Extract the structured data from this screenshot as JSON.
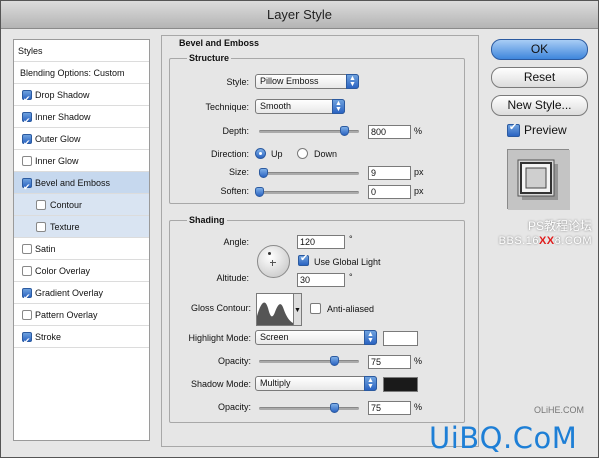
{
  "window": {
    "title": "Layer Style"
  },
  "left_list": {
    "items": [
      {
        "label": "Styles",
        "checkbox": false,
        "checked": false,
        "selected": false,
        "sub": false
      },
      {
        "label": "Blending Options: Custom",
        "checkbox": false,
        "checked": false,
        "selected": false,
        "sub": false
      },
      {
        "label": "Drop Shadow",
        "checkbox": true,
        "checked": true,
        "selected": false,
        "sub": false
      },
      {
        "label": "Inner Shadow",
        "checkbox": true,
        "checked": true,
        "selected": false,
        "sub": false
      },
      {
        "label": "Outer Glow",
        "checkbox": true,
        "checked": true,
        "selected": false,
        "sub": false
      },
      {
        "label": "Inner Glow",
        "checkbox": true,
        "checked": false,
        "selected": false,
        "sub": false
      },
      {
        "label": "Bevel and Emboss",
        "checkbox": true,
        "checked": true,
        "selected": true,
        "sub": false
      },
      {
        "label": "Contour",
        "checkbox": true,
        "checked": false,
        "selected": false,
        "sub": true
      },
      {
        "label": "Texture",
        "checkbox": true,
        "checked": false,
        "selected": false,
        "sub": true
      },
      {
        "label": "Satin",
        "checkbox": true,
        "checked": false,
        "selected": false,
        "sub": false
      },
      {
        "label": "Color Overlay",
        "checkbox": true,
        "checked": false,
        "selected": false,
        "sub": false
      },
      {
        "label": "Gradient Overlay",
        "checkbox": true,
        "checked": true,
        "selected": false,
        "sub": false
      },
      {
        "label": "Pattern Overlay",
        "checkbox": true,
        "checked": false,
        "selected": false,
        "sub": false
      },
      {
        "label": "Stroke",
        "checkbox": true,
        "checked": true,
        "selected": false,
        "sub": false
      }
    ]
  },
  "panel": {
    "title": "Bevel and Emboss",
    "structure": {
      "title": "Structure",
      "style_label": "Style:",
      "style_value": "Pillow Emboss",
      "technique_label": "Technique:",
      "technique_value": "Smooth",
      "depth_label": "Depth:",
      "depth_value": "800",
      "depth_unit": "%",
      "depth_level": 0.85,
      "direction_label": "Direction:",
      "direction_up": "Up",
      "direction_down": "Down",
      "direction_selected": "Up",
      "size_label": "Size:",
      "size_value": "9",
      "size_unit": "px",
      "size_level": 0.04,
      "soften_label": "Soften:",
      "soften_value": "0",
      "soften_unit": "px",
      "soften_level": 0.0
    },
    "shading": {
      "title": "Shading",
      "angle_label": "Angle:",
      "angle_value": "120",
      "angle_unit": "°",
      "use_global_light": "Use Global Light",
      "use_global_light_checked": true,
      "altitude_label": "Altitude:",
      "altitude_value": "30",
      "altitude_unit": "°",
      "gloss_contour_label": "Gloss Contour:",
      "anti_aliased": "Anti-aliased",
      "anti_aliased_checked": false,
      "highlight_mode_label": "Highlight Mode:",
      "highlight_mode_value": "Screen",
      "highlight_color": "#ffffff",
      "highlight_opacity_label": "Opacity:",
      "highlight_opacity_value": "75",
      "highlight_opacity_unit": "%",
      "highlight_opacity_level": 0.75,
      "shadow_mode_label": "Shadow Mode:",
      "shadow_mode_value": "Multiply",
      "shadow_color": "#1a1a1a",
      "shadow_opacity_label": "Opacity:",
      "shadow_opacity_value": "75",
      "shadow_opacity_unit": "%",
      "shadow_opacity_level": 0.75
    }
  },
  "buttons": {
    "ok": "OK",
    "cancel": "Reset",
    "new_style": "New Style...",
    "preview": "Preview",
    "preview_checked": true
  },
  "watermarks": {
    "line1": "PS教程论坛",
    "line2_prefix": "BBS.16",
    "line2_red": "XX",
    "line2_suffix": "8.COM",
    "line3": "OLiHE.COM",
    "logo": "UiBQ.CoM"
  }
}
